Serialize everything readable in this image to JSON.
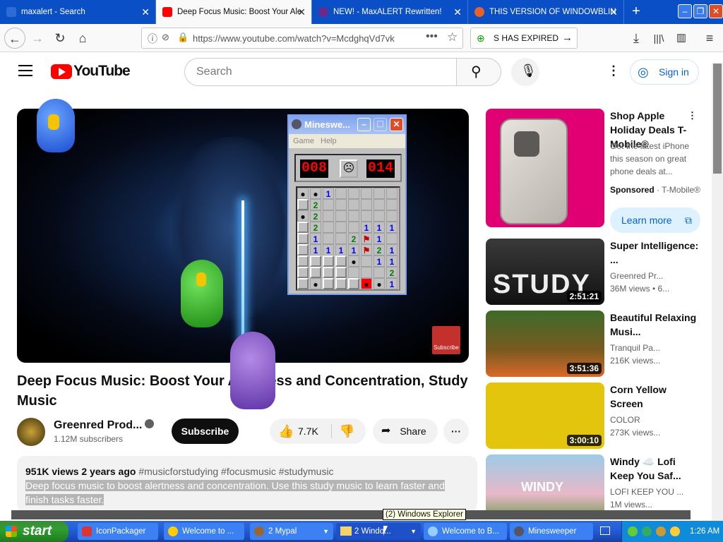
{
  "browser": {
    "tabs": [
      {
        "label": "maxalert - Search"
      },
      {
        "label": "Deep Focus Music: Boost Your Ale"
      },
      {
        "label": "NEW! - MaxALERT Rewritten!"
      },
      {
        "label": "THIS VERSION OF WINDOWBLIN"
      }
    ],
    "url": "https://www.youtube.com/watch?v=McdghqVd7vk",
    "addon_text": "S HAS EXPIRED"
  },
  "youtube": {
    "logo_text": "YouTube",
    "search_placeholder": "Search",
    "signin_label": "Sign in",
    "video_title": "Deep Focus Music: Boost Your Alertness and Concentration, Study Music",
    "channel_name": "Greenred Prod...",
    "subscribers": "1.12M subscribers",
    "subscribe_label": "Subscribe",
    "likes": "7.7K",
    "share_label": "Share",
    "watermark_label": "Subscribe",
    "description": {
      "stats": "951K views  2 years ago",
      "tags": "#musicforstudying #focusmusic #studymusic",
      "text": "Deep focus music to boost alertness and concentration. Use this study music to learn faster and finish tasks faster."
    },
    "recommendations": [
      {
        "title": "Shop Apple Holiday Deals T-Mobile®",
        "desc": "Get the latest iPhone this season on great phone deals at...",
        "sponsored": "Sponsored",
        "advertiser": "· T-Mobile®",
        "cta": "Learn more"
      },
      {
        "title": "Super Intelligence: ...",
        "channel": "Greenred Pr...",
        "views": "36M views  • 6...",
        "duration": "2:51:21",
        "thumb_text": "STUDY"
      },
      {
        "title": "Beautiful Relaxing Musi...",
        "channel": "Tranquil Pa...",
        "views": "216K views...",
        "duration": "3:51:36"
      },
      {
        "title": "Corn Yellow Screen",
        "channel": "COLOR",
        "views": "273K views...",
        "duration": "3:00:10"
      },
      {
        "title": "Windy ☁️ Lofi Keep You Saf...",
        "channel": "LOFI KEEP YOU ...",
        "views": "1M views...",
        "thumb_text": "WINDY"
      }
    ]
  },
  "minesweeper": {
    "title": "Minesweeper",
    "title_short": "Mineswe...",
    "menu": [
      "Game",
      "Help"
    ],
    "mines_left": "008",
    "timer": "014",
    "grid": [
      "**1.....",
      "#2......",
      "*2......",
      "#2...111",
      "#1..2F1.",
      "#1111F21",
      "####*.11",
      "####...2",
      "#*###X*1"
    ]
  },
  "taskbar": {
    "start_label": "start",
    "items": [
      "IconPackager",
      "Welcome to ...",
      "2 Mypal",
      "2 Windo...",
      "Welcome to B...",
      "Minesweeper"
    ],
    "clock": "1:26 AM",
    "tooltip": "(2) Windows Explorer"
  }
}
